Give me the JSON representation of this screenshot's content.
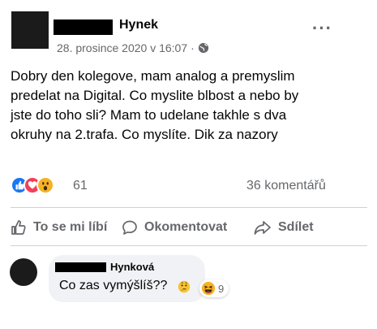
{
  "post": {
    "author": "Hynek",
    "timestamp": "28. prosince 2020 v 16:07",
    "separator": "·",
    "audience_icon": "globe-icon",
    "more_icon": "···",
    "lines": [
      "Dobry den kolegove, mam analog a premyslim",
      "predelat na Digital. Co myslite blbost a nebo by",
      "jste do toho sli? Mam to udelane takhle s dva",
      "okruhy na 2.trafa. Co myslíte. Dik za nazory"
    ]
  },
  "stats": {
    "reaction_count": "61",
    "comment_count": "36 komentářů",
    "reaction_icons": [
      "like-icon",
      "love-icon",
      "wow-icon"
    ]
  },
  "actions": {
    "like": "To se mi líbí",
    "comment": "Okomentovat",
    "share": "Sdílet"
  },
  "comment": {
    "author": "Hynková",
    "text": "Co zas vymýšlíš??",
    "emoji_icon": "thinking-face-icon",
    "reaction_icon": "haha-icon",
    "reaction_count": "9"
  },
  "colors": {
    "like": "#1877f2",
    "love": "#f33e58",
    "wow": "#f7b125",
    "secondary_text": "#65676b"
  }
}
